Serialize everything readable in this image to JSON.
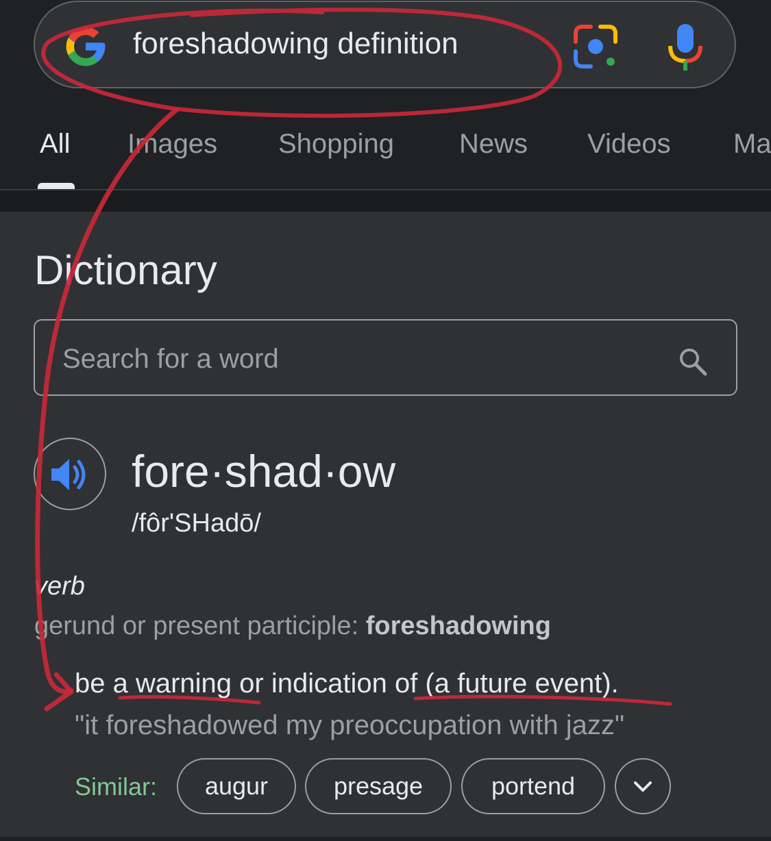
{
  "search": {
    "query": "foreshadowing definition",
    "logo_icon": "google-g-icon",
    "lens_icon": "google-lens-icon",
    "mic_icon": "microphone-icon"
  },
  "tabs": [
    {
      "label": "All",
      "active": true
    },
    {
      "label": "Images",
      "active": false
    },
    {
      "label": "Shopping",
      "active": false
    },
    {
      "label": "News",
      "active": false
    },
    {
      "label": "Videos",
      "active": false
    },
    {
      "label": "Ma",
      "active": false
    }
  ],
  "dictionary": {
    "heading": "Dictionary",
    "search_placeholder": "Search for a word",
    "search_icon": "search-icon",
    "headword": "fore·shad·ow",
    "phonetic": "/fôr'SHadō/",
    "speaker_icon": "speaker-icon",
    "part_of_speech": "verb",
    "gerund_label": "gerund or present participle:",
    "gerund_word": "foreshadowing",
    "definition": "be a warning or indication of (a future event).",
    "example": "\"it foreshadowed my preoccupation with jazz\"",
    "similar_label": "Similar:",
    "similar": [
      "augur",
      "presage",
      "portend"
    ],
    "expand_icon": "chevron-down-icon"
  },
  "colors": {
    "background": "#303134",
    "header_background": "#202124",
    "annotation_red": "#d7263d",
    "similar_green": "#81c995",
    "speaker_blue": "#4285f4"
  }
}
